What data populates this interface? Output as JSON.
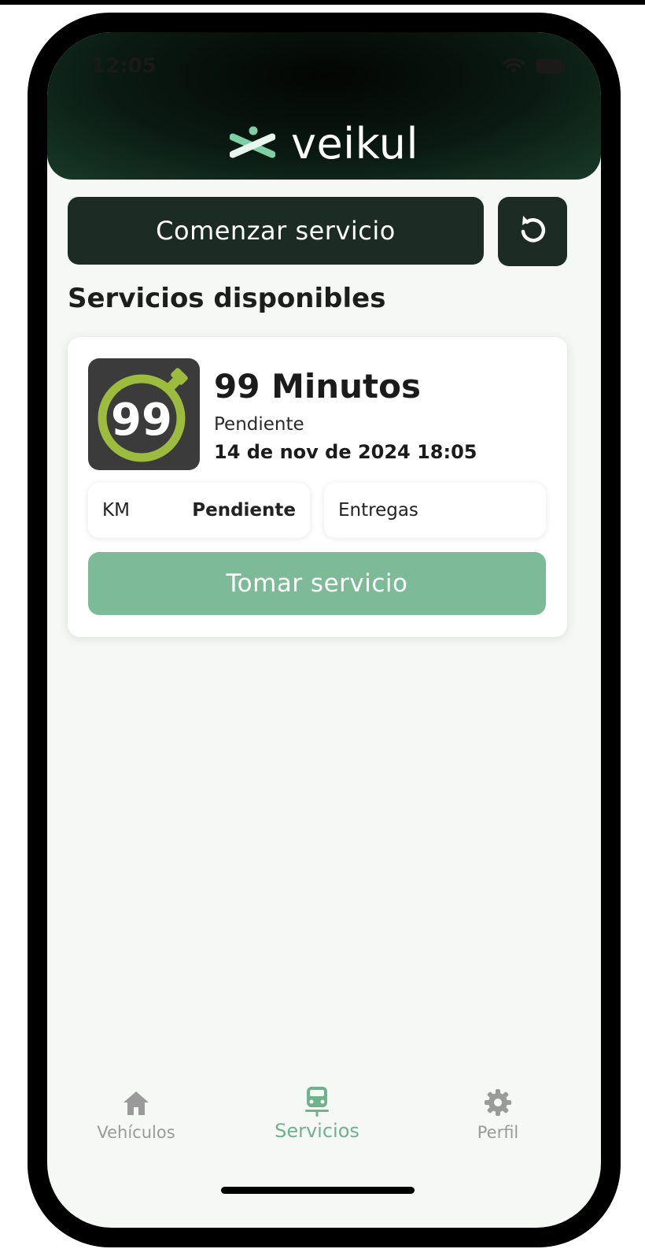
{
  "status_bar": {
    "time": "12:05"
  },
  "brand": {
    "name": "veikul",
    "logo_color": "#7dcfa6"
  },
  "actions": {
    "start_service_label": "Comenzar servicio",
    "refresh_icon": "refresh-icon"
  },
  "section": {
    "title": "Servicios disponibles"
  },
  "service_card": {
    "logo_text": "99",
    "name": "99 Minutos",
    "status": "Pendiente",
    "datetime": "14 de nov de 2024 18:05",
    "km_label": "KM",
    "km_value": "Pendiente",
    "deliveries_label": "Entregas",
    "take_button_label": "Tomar servicio"
  },
  "tabs": [
    {
      "label": "Vehículos",
      "icon": "home-icon",
      "active": false
    },
    {
      "label": "Servicios",
      "icon": "car-icon",
      "active": true
    },
    {
      "label": "Perfil",
      "icon": "gear-icon",
      "active": false
    }
  ],
  "colors": {
    "primary_dark": "#1c2b23",
    "accent_green": "#7dba98",
    "active_tab": "#6fb28c",
    "inactive_tab": "#9a9a9a"
  }
}
